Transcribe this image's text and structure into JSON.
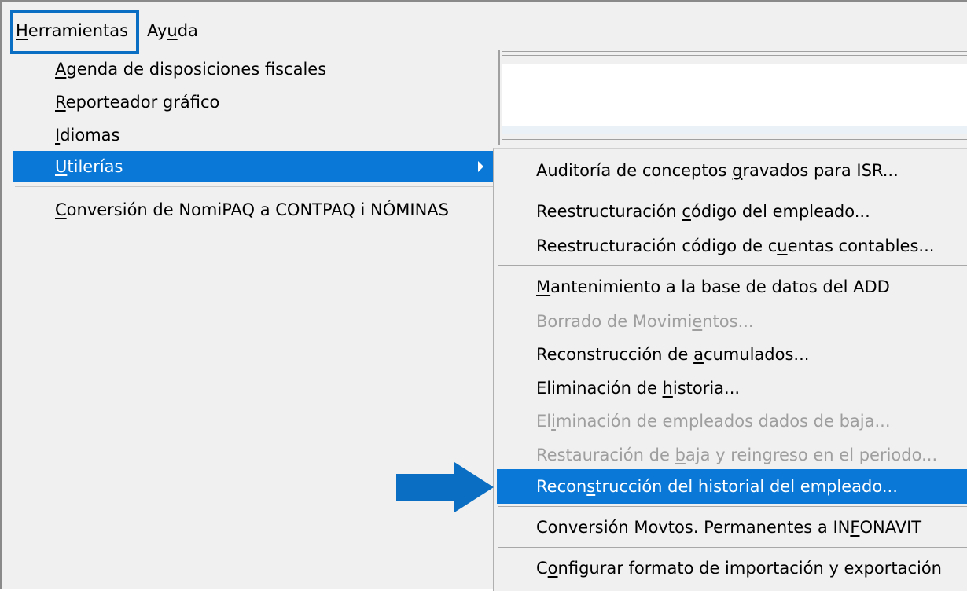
{
  "menubar": {
    "items": [
      {
        "pre": "",
        "key": "H",
        "post": "erramientas"
      },
      {
        "pre": "Ay",
        "key": "u",
        "post": "da"
      }
    ]
  },
  "dropdown": {
    "items": [
      {
        "pre": "",
        "key": "A",
        "post": "genda de disposiciones fiscales"
      },
      {
        "pre": "",
        "key": "R",
        "post": "eporteador gráfico"
      },
      {
        "pre": "",
        "key": "I",
        "post": "diomas"
      },
      {
        "pre": "",
        "key": "U",
        "post": "tilerías"
      },
      {
        "pre": "",
        "key": "C",
        "post": "onversión de NomiPAQ a CONTPAQ i NÓMINAS"
      }
    ]
  },
  "submenu": {
    "items": [
      {
        "pre": "Auditoría de conceptos ",
        "key": "g",
        "post": "ravados para ISR..."
      },
      {
        "pre": "Reestructuración ",
        "key": "c",
        "post": "ódigo del empleado..."
      },
      {
        "pre": "Reestructuración código de c",
        "key": "u",
        "post": "entas contables..."
      },
      {
        "pre": "",
        "key": "M",
        "post": "antenimiento a la base de datos del ADD"
      },
      {
        "pre": "Borrado de Movimi",
        "key": "e",
        "post": "ntos..."
      },
      {
        "pre": "Reconstrucción de ",
        "key": "a",
        "post": "cumulados..."
      },
      {
        "pre": "Eliminación de ",
        "key": "h",
        "post": "istoria..."
      },
      {
        "pre": "El",
        "key": "i",
        "post": "minación de empleados dados de baja..."
      },
      {
        "pre": "Restauración de ",
        "key": "b",
        "post": "aja y reingreso en el periodo..."
      },
      {
        "pre": "Recon",
        "key": "s",
        "post": "trucción del historial del empleado..."
      },
      {
        "pre": "Conversión Movtos. Permanentes a IN",
        "key": "F",
        "post": "ONAVIT"
      },
      {
        "pre": "C",
        "key": "o",
        "post": "nfigurar formato de importación y exportación"
      }
    ]
  },
  "colors": {
    "highlight": "#0a78d7",
    "callout": "#0a6fc2",
    "disabled_text": "#9e9e9e",
    "menu_bg": "#f0f0f0"
  }
}
